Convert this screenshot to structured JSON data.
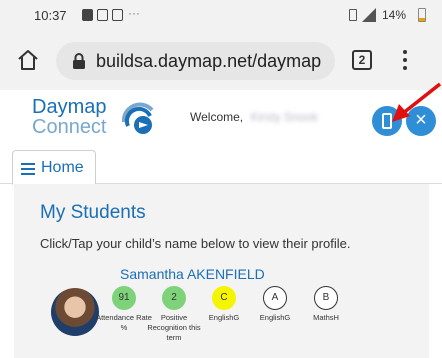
{
  "status_bar": {
    "time": "10:37",
    "battery": "14%",
    "overflow": "···"
  },
  "browser": {
    "url": "buildsa.daymap.net/daymap",
    "tab_count": "2"
  },
  "header": {
    "logo_line1": "Daymap",
    "logo_line2": "Connect",
    "welcome_label": "Welcome,",
    "welcome_name": "Kirsty Snook"
  },
  "nav": {
    "home_label": "Home"
  },
  "main": {
    "title": "My Students",
    "instructions": "Click/Tap your child’s name below to view their profile.",
    "student": {
      "name": "Samantha AKENFIELD",
      "stats": [
        {
          "value": "91",
          "label": "Attendance Rate %",
          "color": "#7ed27a",
          "outlined": false
        },
        {
          "value": "2",
          "label": "Positive Recognition this term",
          "color": "#7ed27a",
          "outlined": false
        },
        {
          "value": "C",
          "label": "EnglishG",
          "color": "#f5f500",
          "outlined": false
        },
        {
          "value": "A",
          "label": "EnglishG",
          "color": "#ffffff",
          "outlined": true
        },
        {
          "value": "B",
          "label": "MathsH",
          "color": "#ffffff",
          "outlined": true
        }
      ]
    }
  },
  "colors": {
    "brand_blue": "#1b6fb5",
    "button_blue": "#2f8ed6",
    "arrow_red": "#e01010"
  }
}
